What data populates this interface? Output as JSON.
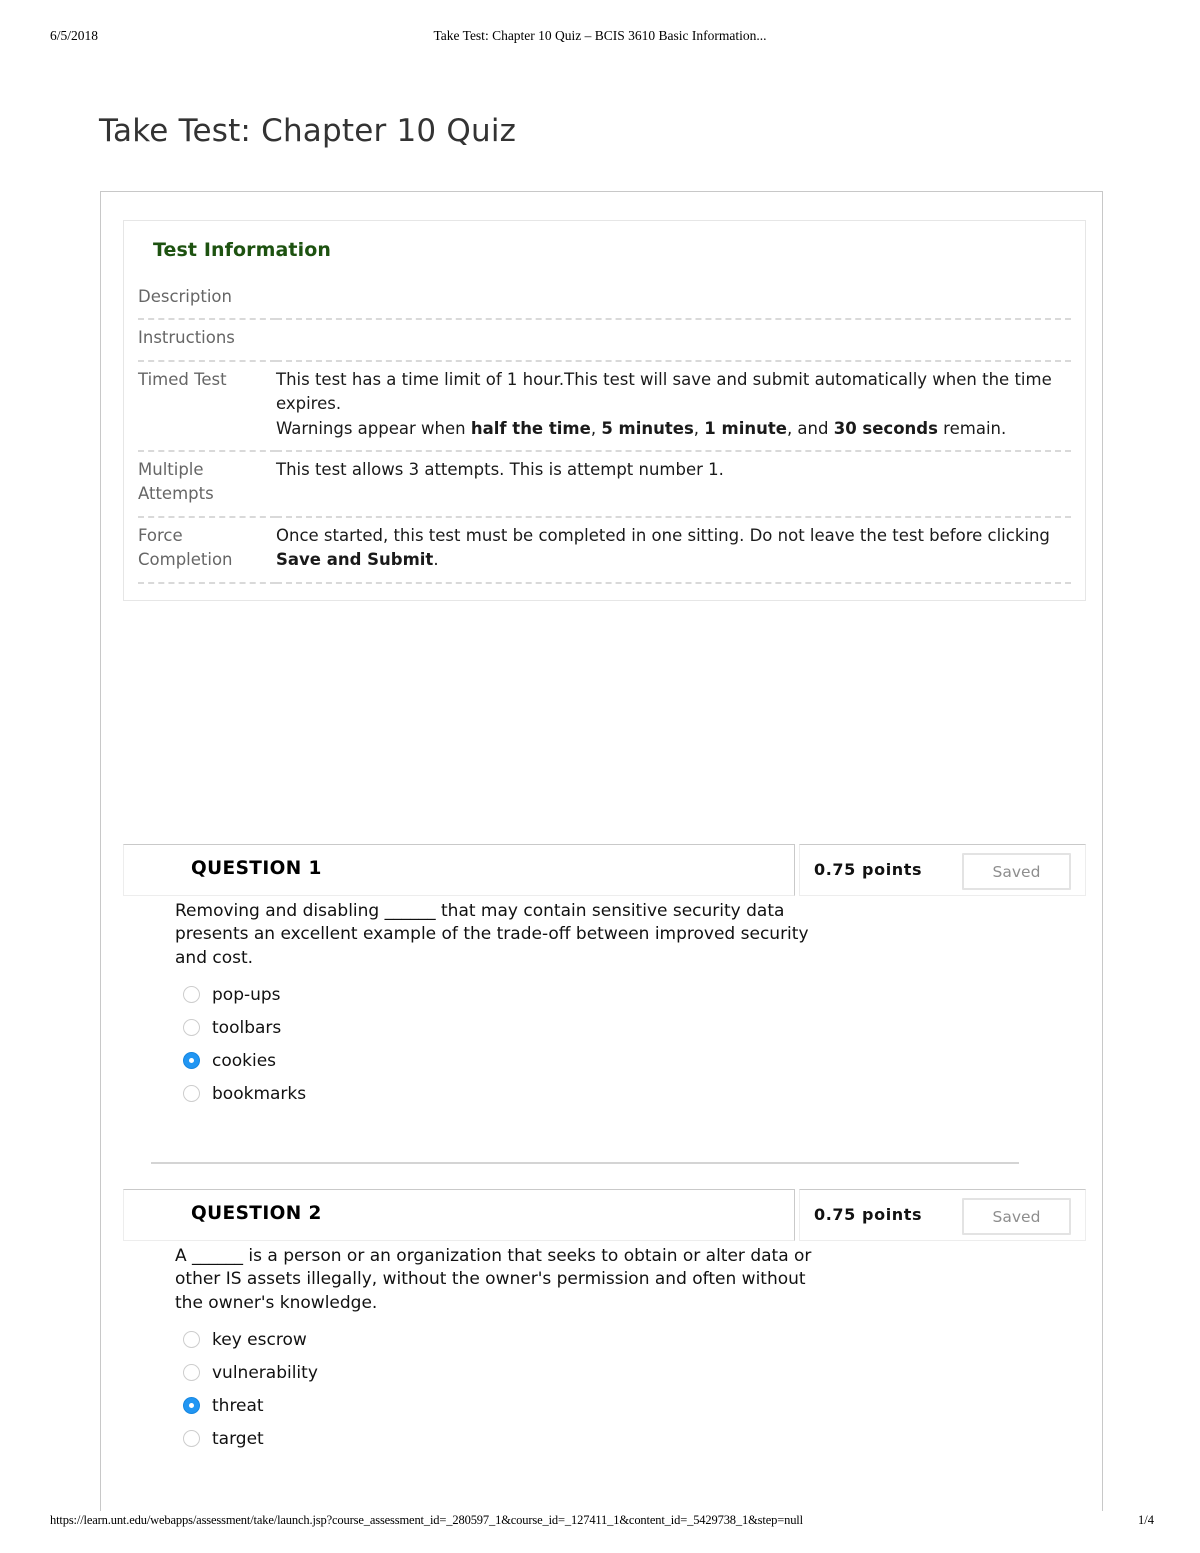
{
  "print_header": {
    "date": "6/5/2018",
    "title": "Take Test: Chapter 10 Quiz – BCIS 3610 Basic Information..."
  },
  "print_footer": {
    "url": "https://learn.unt.edu/webapps/assessment/take/launch.jsp?course_assessment_id=_280597_1&course_id=_127411_1&content_id=_5429738_1&step=null",
    "page": "1/4"
  },
  "page_title": "Take Test: Chapter 10 Quiz",
  "test_information": {
    "heading": "Test Information",
    "heading_color": "#1d5210",
    "rows": [
      {
        "label": "Description",
        "value": ""
      },
      {
        "label": "Instructions",
        "value": ""
      },
      {
        "label": "Timed Test",
        "line1": "This test has a time limit of 1 hour.This test will save and submit automatically when the time expires.",
        "line2_pre": "Warnings appear when ",
        "line2_b1": "half the time",
        "line2_mid1": ", ",
        "line2_b2": "5 minutes",
        "line2_mid2": ", ",
        "line2_b3": "1 minute",
        "line2_mid3": ", and ",
        "line2_b4": "30 seconds",
        "line2_post": " remain."
      },
      {
        "label": "Multiple Attempts",
        "value": "This test allows 3 attempts. This is attempt number 1."
      },
      {
        "label": "Force Completion",
        "value_pre": "Once started, this test must be completed in one sitting. Do not leave the test before clicking ",
        "value_bold": "Save and Submit",
        "value_post": "."
      }
    ]
  },
  "questions": [
    {
      "label": "QUESTION 1",
      "points": "0.75 points",
      "status_button": "Saved",
      "text": "Removing and disabling ______ that may contain sensitive security data presents an excellent example of the trade-off between improved security and cost.",
      "options": [
        {
          "text": "pop-ups",
          "selected": false
        },
        {
          "text": "toolbars",
          "selected": false
        },
        {
          "text": "cookies",
          "selected": true
        },
        {
          "text": "bookmarks",
          "selected": false
        }
      ]
    },
    {
      "label": "QUESTION 2",
      "points": "0.75 points",
      "status_button": "Saved",
      "text": "A ______ is a person or an organization that seeks to obtain or alter data or other IS assets illegally, without the owner's permission and often without the owner's knowledge.",
      "options": [
        {
          "text": "key escrow",
          "selected": false
        },
        {
          "text": "vulnerability",
          "selected": false
        },
        {
          "text": "threat",
          "selected": true
        },
        {
          "text": "target",
          "selected": false
        }
      ]
    }
  ]
}
